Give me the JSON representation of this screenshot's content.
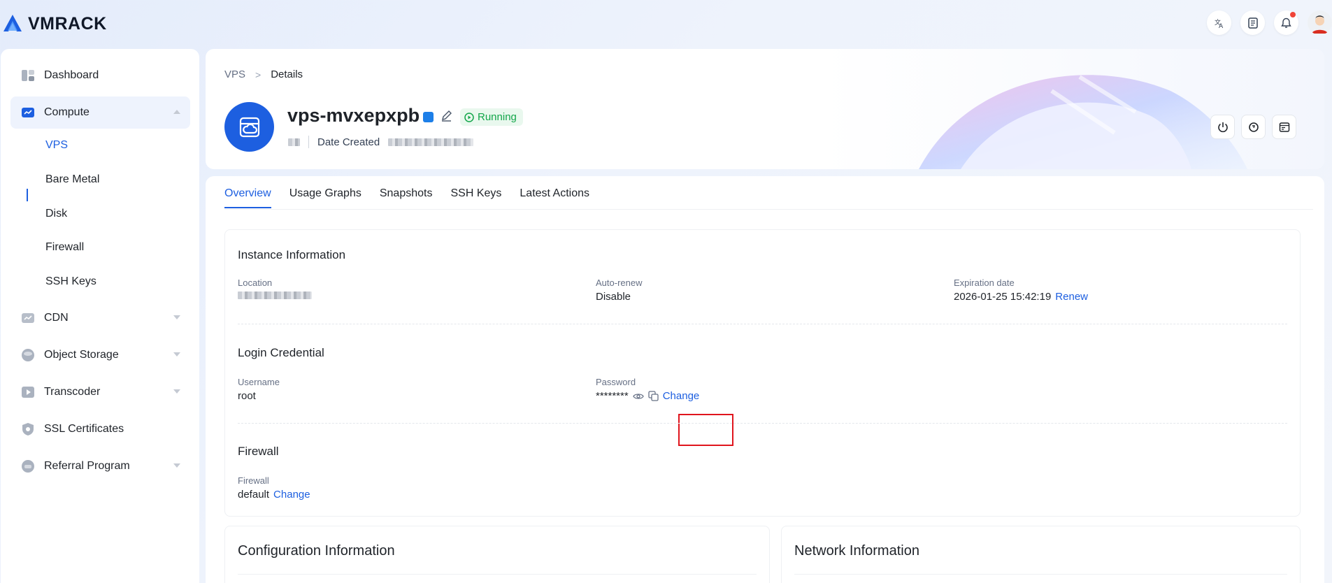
{
  "brand": {
    "name": "VMRACK",
    "accent": "#1d5fe0"
  },
  "topbar": {
    "icons": [
      "translate-icon",
      "document-icon",
      "bell-icon",
      "avatar"
    ]
  },
  "sidebar": {
    "items": [
      {
        "label": "Dashboard",
        "icon": "dashboard-icon"
      },
      {
        "label": "Compute",
        "icon": "compute-icon",
        "expanded": true,
        "children": [
          "VPS",
          "Bare Metal",
          "Disk",
          "Firewall",
          "SSH Keys"
        ],
        "active_child": "VPS"
      },
      {
        "label": "CDN",
        "icon": "cdn-icon"
      },
      {
        "label": "Object Storage",
        "icon": "object-storage-icon"
      },
      {
        "label": "Transcoder",
        "icon": "transcoder-icon"
      },
      {
        "label": "SSL Certificates",
        "icon": "ssl-icon"
      },
      {
        "label": "Referral Program",
        "icon": "referral-icon"
      }
    ]
  },
  "header": {
    "breadcrumb": {
      "parent": "VPS",
      "separator": ">",
      "current": "Details"
    },
    "vps_name": "vps-mvxepxpb",
    "status": "Running",
    "status_color": "#13a64a",
    "date_created_label": "Date Created",
    "actions": [
      "power-icon",
      "restart-icon",
      "console-icon"
    ]
  },
  "tabs": [
    "Overview",
    "Usage Graphs",
    "Snapshots",
    "SSH Keys",
    "Latest Actions"
  ],
  "active_tab": "Overview",
  "instance_info": {
    "title": "Instance Information",
    "location_label": "Location",
    "auto_renew_label": "Auto-renew",
    "auto_renew_value": "Disable",
    "expiration_label": "Expiration date",
    "expiration_value": "2026-01-25 15:42:19",
    "renew_link": "Renew"
  },
  "login_credential": {
    "title": "Login Credential",
    "username_label": "Username",
    "username_value": "root",
    "password_label": "Password",
    "password_value": "********",
    "change_link": "Change"
  },
  "firewall": {
    "title": "Firewall",
    "label": "Firewall",
    "value": "default",
    "change_link": "Change"
  },
  "configuration": {
    "title": "Configuration Information"
  },
  "network": {
    "title": "Network Information"
  }
}
